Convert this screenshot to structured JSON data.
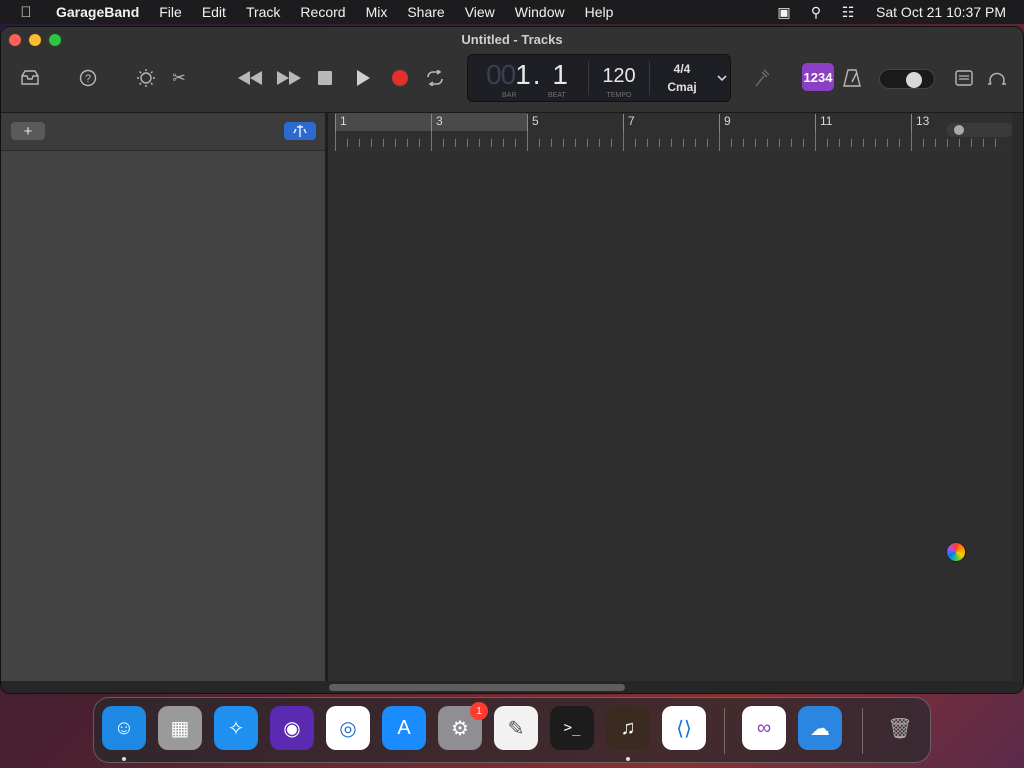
{
  "menubar": {
    "app_name": "GarageBand",
    "items": [
      "File",
      "Edit",
      "Track",
      "Record",
      "Mix",
      "Share",
      "View",
      "Window",
      "Help"
    ],
    "clock": "Sat Oct 21  10:37 PM"
  },
  "window": {
    "title": "Untitled - Tracks"
  },
  "lcd": {
    "position_dim": "00",
    "position_value": "1. 1",
    "bar_label": "BAR",
    "beat_label": "BEAT",
    "tempo": "120",
    "tempo_label": "TEMPO",
    "time_signature": "4/4",
    "key": "Cmaj"
  },
  "count_in": "1234",
  "track_header": {
    "add_label": "+"
  },
  "ruler": {
    "bars": [
      "1",
      "3",
      "5",
      "7",
      "9",
      "11",
      "13"
    ]
  },
  "dock": {
    "apps": [
      {
        "name": "Finder",
        "icon": "finder-icon",
        "color": "#1e88e5",
        "running": true
      },
      {
        "name": "Launchpad",
        "icon": "launchpad-icon",
        "color": "#9a9a9a",
        "running": false
      },
      {
        "name": "Safari",
        "icon": "safari-icon",
        "color": "#1f8ff0",
        "running": false
      },
      {
        "name": "Firefox",
        "icon": "firefox-icon",
        "color": "#5a2ab0",
        "running": false
      },
      {
        "name": "Chrome",
        "icon": "chrome-icon",
        "color": "#ffffff",
        "running": false
      },
      {
        "name": "App Store",
        "icon": "app-store-icon",
        "color": "#1a8cff",
        "running": false
      },
      {
        "name": "System Settings",
        "icon": "settings-icon",
        "color": "#8e8e93",
        "running": false,
        "badge": "1"
      },
      {
        "name": "TextEdit",
        "icon": "textedit-icon",
        "color": "#f2f2f2",
        "running": false
      },
      {
        "name": "Terminal",
        "icon": "terminal-icon",
        "color": "#1c1c1c",
        "running": false
      },
      {
        "name": "GarageBand",
        "icon": "garageband-icon",
        "color": "#3a2a20",
        "running": true
      },
      {
        "name": "Visual Studio Code",
        "icon": "vscode-icon",
        "color": "#ffffff",
        "running": false
      },
      {
        "name": "Visual Studio",
        "icon": "visual-studio-icon",
        "color": "#ffffff",
        "running": false
      },
      {
        "name": "Weather",
        "icon": "weather-icon",
        "color": "#2a86e0",
        "running": false
      },
      {
        "name": "Trash",
        "icon": "trash-icon",
        "color": "transparent",
        "running": false
      }
    ]
  }
}
